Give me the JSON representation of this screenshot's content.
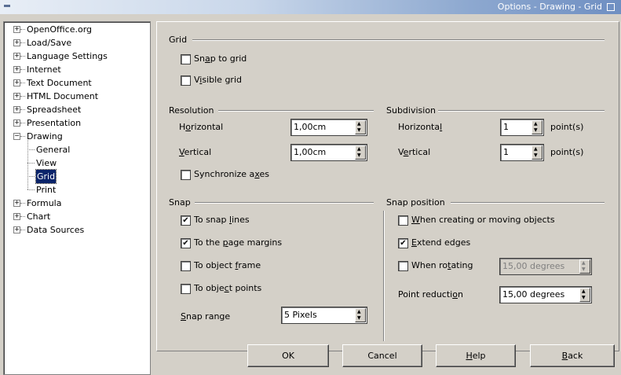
{
  "window": {
    "title": "Options - Drawing - Grid"
  },
  "tree": {
    "items": [
      {
        "label": "OpenOffice.org",
        "expander": "⊞"
      },
      {
        "label": "Load/Save",
        "expander": "⊞"
      },
      {
        "label": "Language Settings",
        "expander": "⊞"
      },
      {
        "label": "Internet",
        "expander": "⊞"
      },
      {
        "label": "Text Document",
        "expander": "⊞"
      },
      {
        "label": "HTML Document",
        "expander": "⊞"
      },
      {
        "label": "Spreadsheet",
        "expander": "⊞"
      },
      {
        "label": "Presentation",
        "expander": "⊞"
      },
      {
        "label": "Drawing",
        "expander": "⊟"
      },
      {
        "label": "General"
      },
      {
        "label": "View"
      },
      {
        "label": "Grid"
      },
      {
        "label": "Print"
      },
      {
        "label": "Formula",
        "expander": "⊞"
      },
      {
        "label": "Chart",
        "expander": "⊞"
      },
      {
        "label": "Data Sources",
        "expander": "⊞"
      }
    ]
  },
  "grid": {
    "title": "Grid",
    "snap_to_grid": {
      "pre": "Sn",
      "u": "a",
      "post": "p to grid",
      "checked": false
    },
    "visible_grid": {
      "pre": "V",
      "u": "i",
      "post": "sible grid",
      "checked": false
    }
  },
  "resolution": {
    "title": "Resolution",
    "horizontal_label": {
      "pre": "H",
      "u": "o",
      "post": "rizontal"
    },
    "horizontal_value": "1,00cm",
    "vertical_label": {
      "pre": "",
      "u": "V",
      "post": "ertical"
    },
    "vertical_value": "1,00cm",
    "sync_axes": {
      "pre": "Synchronize a",
      "u": "x",
      "post": "es",
      "checked": false
    }
  },
  "subdivision": {
    "title": "Subdivision",
    "horizontal_label": {
      "pre": "Horizonta",
      "u": "l",
      "post": ""
    },
    "horizontal_value": "1",
    "vertical_label": {
      "pre": "V",
      "u": "e",
      "post": "rtical"
    },
    "vertical_value": "1",
    "unit": "point(s)"
  },
  "snap": {
    "title": "Snap",
    "snap_lines": {
      "pre": "To snap ",
      "u": "l",
      "post": "ines",
      "checked": true
    },
    "page_margins": {
      "pre": "To the ",
      "u": "p",
      "post": "age margins",
      "checked": true
    },
    "object_frame": {
      "pre": "To object ",
      "u": "f",
      "post": "rame",
      "checked": false
    },
    "object_points": {
      "pre": "To obje",
      "u": "c",
      "post": "t points",
      "checked": false
    },
    "range_label": {
      "pre": "",
      "u": "S",
      "post": "nap range"
    },
    "range_value": "5 Pixels"
  },
  "snap_position": {
    "title": "Snap position",
    "creating_moving": {
      "pre": "",
      "u": "W",
      "post": "hen creating or moving objects",
      "checked": false
    },
    "extend_edges": {
      "pre": "",
      "u": "E",
      "post": "xtend edges",
      "checked": true
    },
    "rotating": {
      "pre": "When ro",
      "u": "t",
      "post": "ating",
      "checked": false
    },
    "rotating_value": "15,00 degrees",
    "point_reduction_label": {
      "pre": "Point reducti",
      "u": "o",
      "post": "n"
    },
    "point_reduction_value": "15,00 degrees"
  },
  "buttons": {
    "ok": {
      "pre": "OK",
      "u": "",
      "post": ""
    },
    "cancel": {
      "pre": "Cancel",
      "u": "",
      "post": ""
    },
    "help": {
      "pre": "",
      "u": "H",
      "post": "elp"
    },
    "back": {
      "pre": "",
      "u": "B",
      "post": "ack"
    }
  },
  "check_glyph": "✔"
}
